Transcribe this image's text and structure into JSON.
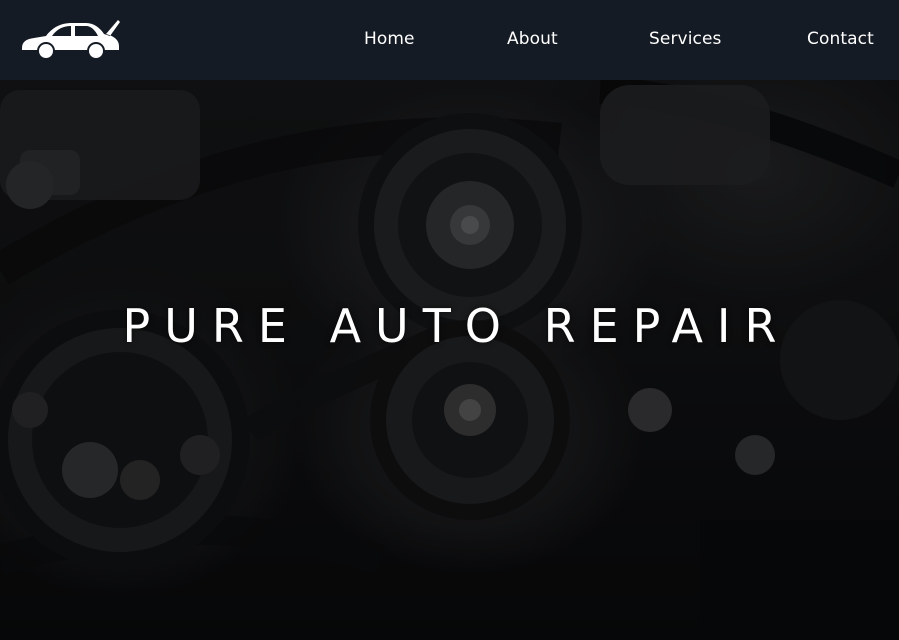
{
  "navbar": {
    "logo_icon": "car-open-hood-icon",
    "links": [
      {
        "label": "Home"
      },
      {
        "label": "About"
      },
      {
        "label": "Services"
      },
      {
        "label": "Contact"
      }
    ]
  },
  "hero": {
    "title": "PURE AUTO REPAIR",
    "background": "engine-bay-photo"
  },
  "colors": {
    "navbar_bg": "#151b24",
    "text": "#ffffff",
    "overlay": "#0d0f13"
  }
}
